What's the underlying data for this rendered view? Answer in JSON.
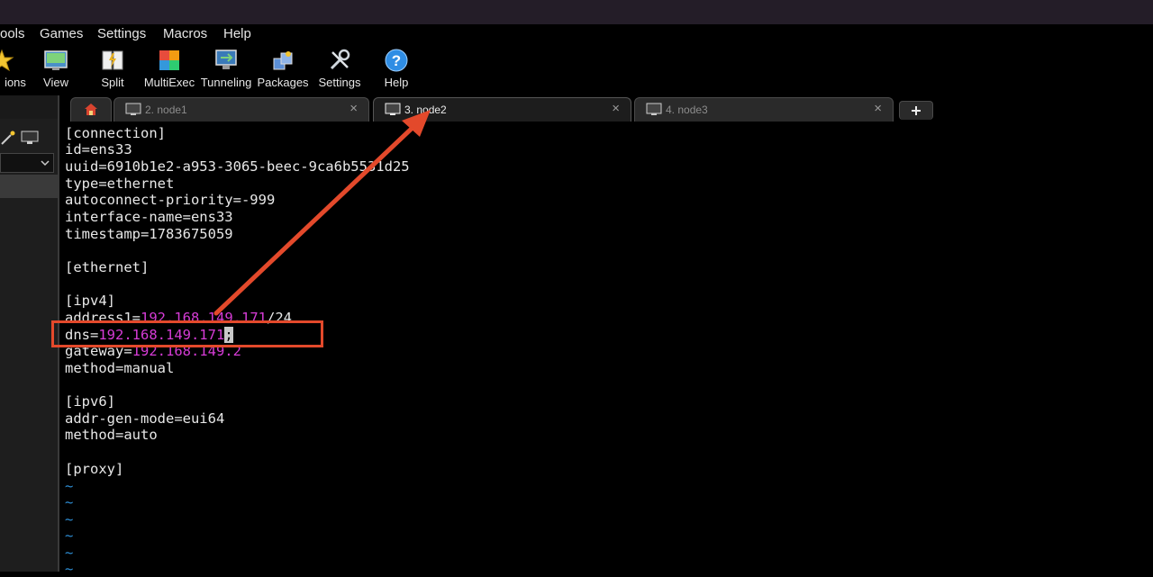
{
  "menu": [
    "ools",
    "Games",
    "Settings",
    "Macros",
    "Help"
  ],
  "toolbar": [
    {
      "label": "ions",
      "icon": "star-icon"
    },
    {
      "label": "View",
      "icon": "view-icon"
    },
    {
      "label": "Split",
      "icon": "split-icon"
    },
    {
      "label": "MultiExec",
      "icon": "multiexec-icon"
    },
    {
      "label": "Tunneling",
      "icon": "tunneling-icon"
    },
    {
      "label": "Packages",
      "icon": "packages-icon"
    },
    {
      "label": "Settings",
      "icon": "settings-icon"
    },
    {
      "label": "Help",
      "icon": "help-icon"
    }
  ],
  "tabs": [
    {
      "label": "2. node1",
      "close": "×"
    },
    {
      "label": "3. node2",
      "close": "×"
    },
    {
      "label": "4. node3",
      "close": "×"
    }
  ],
  "terminal": {
    "l1": "[connection]",
    "l2": "id=ens33",
    "l3": "uuid=6910b1e2-a953-3065-beec-9ca6b5531d25",
    "l4": "type=ethernet",
    "l5": "autoconnect-priority=-999",
    "l6": "interface-name=ens33",
    "l7": "timestamp=1783675059",
    "l9": "[ethernet]",
    "l11": "[ipv4]",
    "address_key": "address1=",
    "address_ip": "192.168.149.171",
    "address_mask": "/24",
    "dns_key": "dns=",
    "dns_ip": "192.168.149.171",
    "dns_cursor": ";",
    "gateway_key": "gateway=",
    "gateway_ip": "192.168.149.2",
    "method4": "method=manual",
    "l17": "[ipv6]",
    "l18": "addr-gen-mode=eui64",
    "l19": "method=auto",
    "l21": "[proxy]",
    "tilde": "~"
  },
  "colors": {
    "accent": "#e3492b",
    "ip": "#d63cd6",
    "tilde": "#2e8fd6"
  }
}
